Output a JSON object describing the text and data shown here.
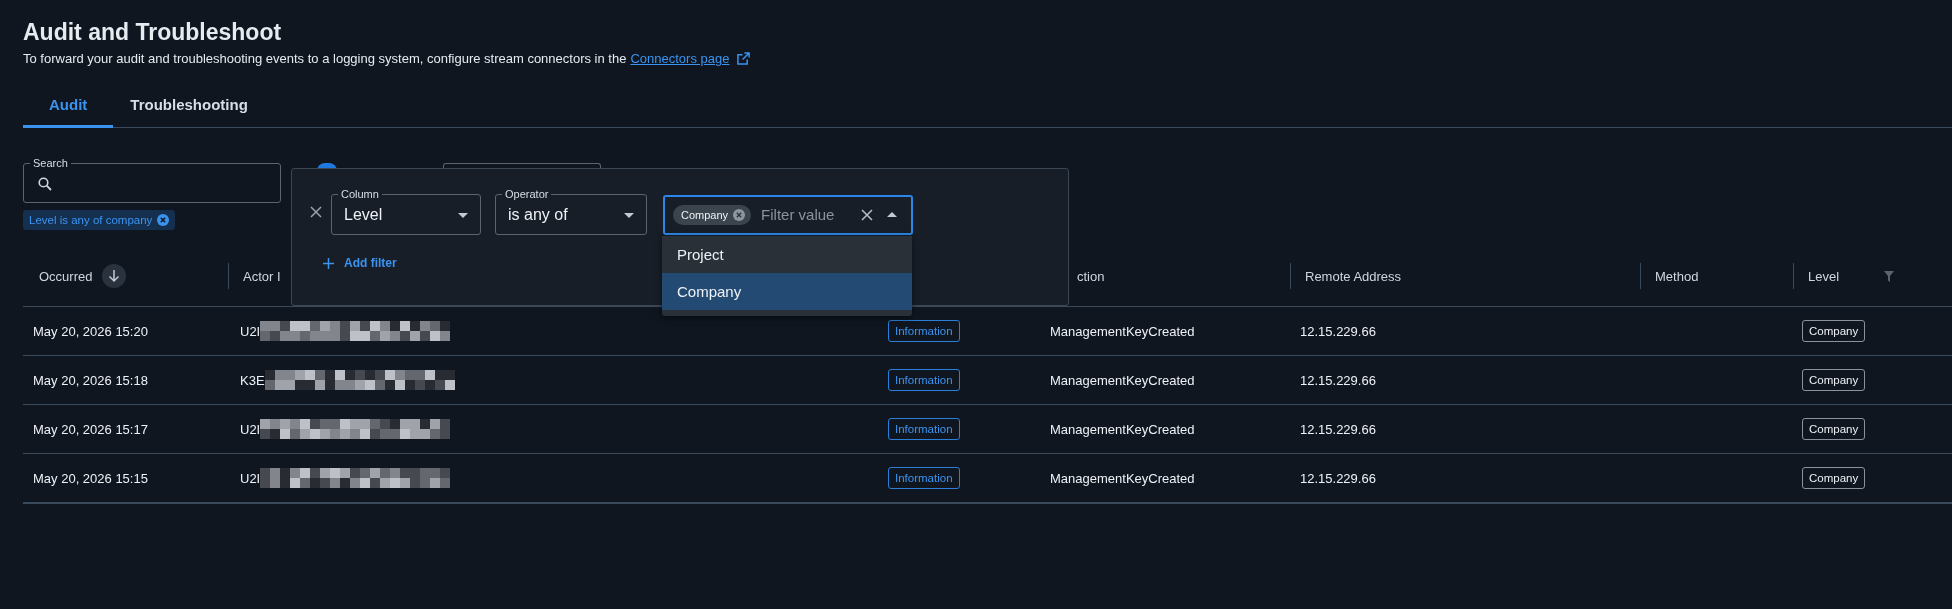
{
  "page": {
    "title": "Audit and Troubleshoot",
    "description": "To forward your audit and troubleshooting events to a logging system, configure stream connectors in the",
    "link": "Connectors page"
  },
  "tabs": [
    {
      "label": "Audit",
      "selected": true
    },
    {
      "label": "Troubleshooting",
      "selected": false
    }
  ],
  "search": {
    "label": "Search"
  },
  "active_filters": [
    {
      "label": "Level is any of company"
    }
  ],
  "filter_panel": {
    "column": {
      "label": "Column",
      "value": "Level"
    },
    "operator": {
      "label": "Operator",
      "value": "is any of"
    },
    "value_field": {
      "chips": [
        "Company"
      ],
      "placeholder": "Filter value",
      "expanded": true
    },
    "add_filter": "Add filter",
    "options": [
      {
        "label": "Project",
        "selected": false
      },
      {
        "label": "Company",
        "selected": true
      }
    ]
  },
  "table": {
    "columns": [
      {
        "label": "Occurred",
        "kind": "sort"
      },
      {
        "label": "Actor I",
        "kind": "plain"
      },
      {
        "kind": "hidden"
      },
      {
        "label": "ction",
        "kind": "plain"
      },
      {
        "label": "Remote Address",
        "kind": "plain"
      },
      {
        "label": "Method",
        "kind": "plain"
      },
      {
        "label": "Level",
        "kind": "filter"
      }
    ],
    "rows": [
      {
        "occurred": "May 20, 2026 15:20",
        "actor": "U2I",
        "type": "Information",
        "action": "ManagementKeyCreated",
        "remote_address": "12.15.229.66",
        "level": "Company"
      },
      {
        "occurred": "May 20, 2026 15:18",
        "actor": "K3E",
        "type": "Information",
        "action": "ManagementKeyCreated",
        "remote_address": "12.15.229.66",
        "level": "Company"
      },
      {
        "occurred": "May 20, 2026 15:17",
        "actor": "U2I",
        "type": "Information",
        "action": "ManagementKeyCreated",
        "remote_address": "12.15.229.66",
        "level": "Company"
      },
      {
        "occurred": "May 20, 2026 15:15",
        "actor": "U2I",
        "type": "Information",
        "action": "ManagementKeyCreated",
        "remote_address": "12.15.229.66",
        "level": "Company"
      }
    ]
  }
}
